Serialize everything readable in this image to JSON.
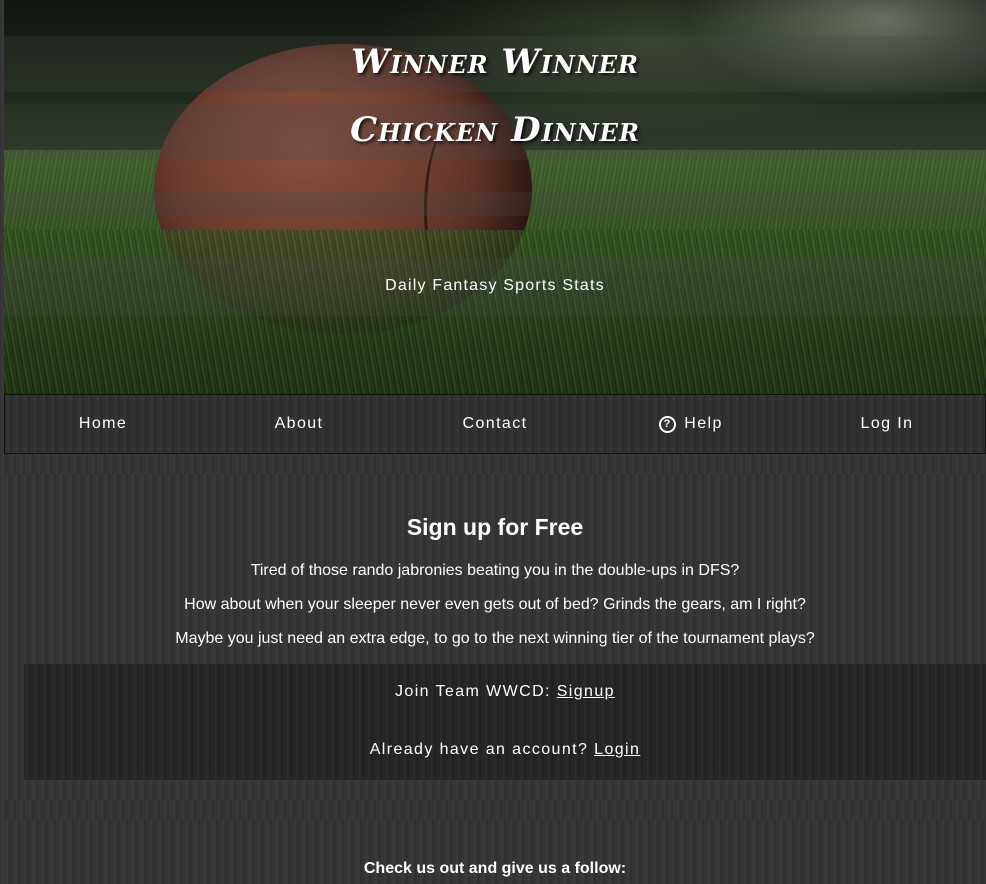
{
  "hero": {
    "title_line1": "Winner Winner",
    "title_line2": "Chicken Dinner",
    "subtitle": "Daily Fantasy Sports Stats"
  },
  "nav": {
    "items": [
      {
        "label": "Home"
      },
      {
        "label": "About"
      },
      {
        "label": "Contact"
      },
      {
        "label": "Help",
        "icon": "question-circle-icon"
      },
      {
        "label": "Log In"
      }
    ]
  },
  "signup": {
    "title": "Sign up for Free",
    "lines": [
      "Tired of those rando jabronies beating you in the double-ups in DFS?",
      "How about when your sleeper never even gets out of bed? Grinds the gears, am I right?",
      "Maybe you just need an extra edge, to go to the next winning tier of the tournament plays?"
    ],
    "join_text": "Join Team WWCD: ",
    "join_link": "Signup",
    "account_text": "Already have an account? ",
    "account_link": "Login"
  },
  "follow": {
    "title": "Check us out and give us a follow:"
  }
}
